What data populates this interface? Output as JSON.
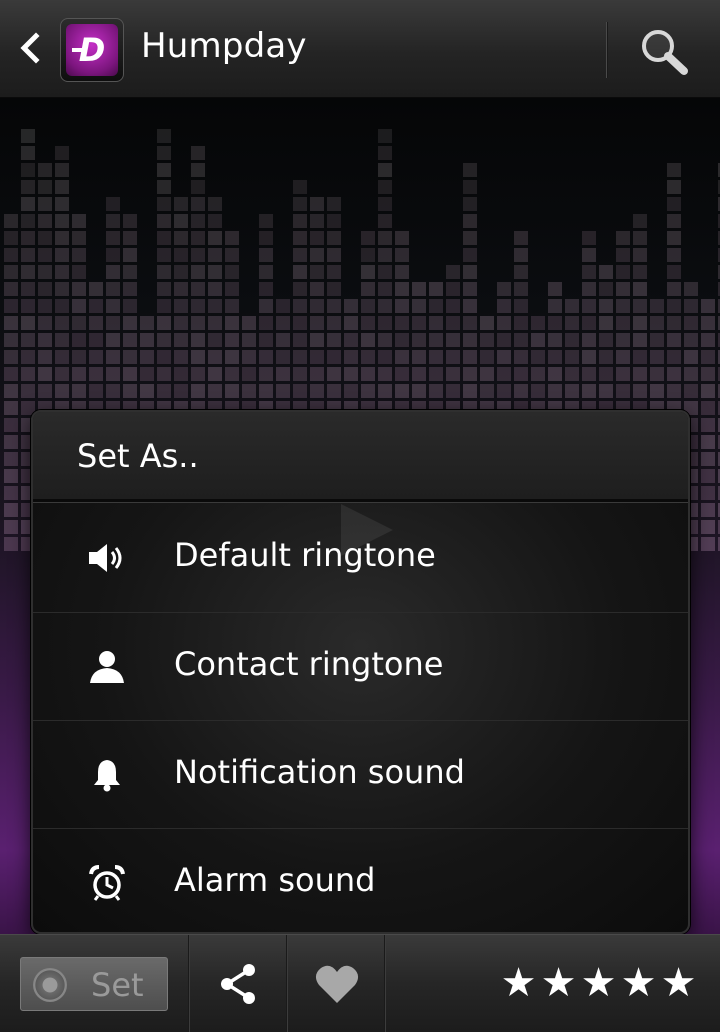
{
  "action_bar": {
    "title": "Humpday",
    "logo_letter": "D"
  },
  "dialog": {
    "title": "Set As..",
    "items": [
      {
        "label": "Default ringtone",
        "icon": "speaker-icon"
      },
      {
        "label": "Contact ringtone",
        "icon": "person-icon"
      },
      {
        "label": "Notification sound",
        "icon": "bell-icon"
      },
      {
        "label": "Alarm sound",
        "icon": "alarm-clock-icon"
      }
    ]
  },
  "bottom_bar": {
    "set_label": "Set",
    "rating": 5,
    "rating_max": 5
  },
  "colors": {
    "accent": "#9b2a9e",
    "text": "#ffffff",
    "disabled_text": "#9a9a9a"
  }
}
